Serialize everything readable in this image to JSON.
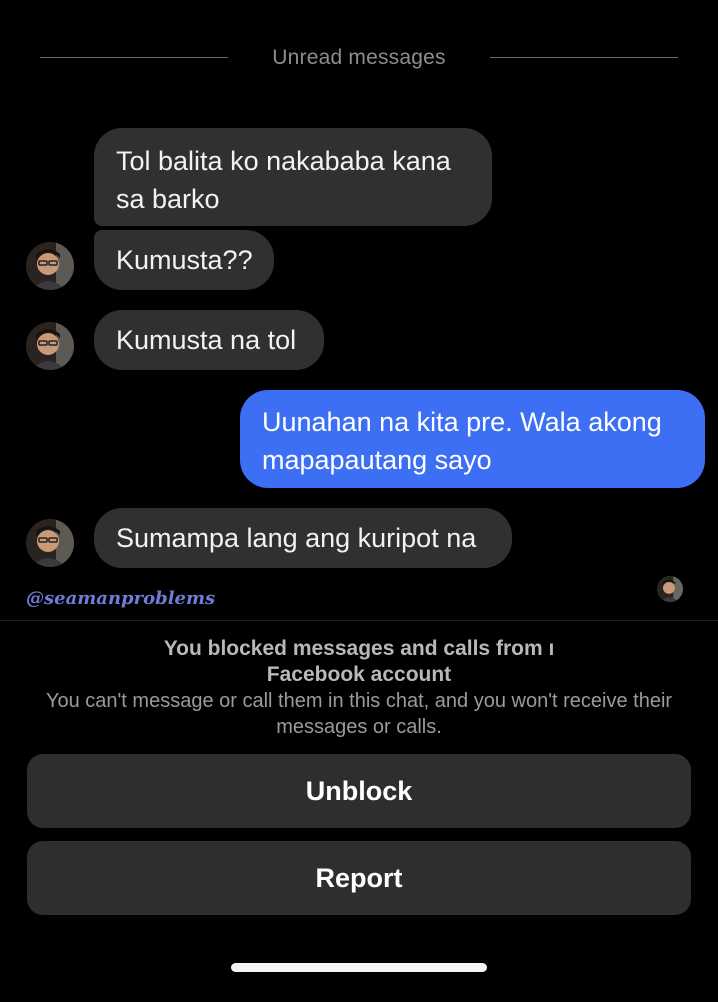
{
  "divider": {
    "label": "Unread messages"
  },
  "messages": [
    {
      "sender": "them",
      "text": "Tol balita ko nakababa kana sa barko",
      "avatar": false
    },
    {
      "sender": "them",
      "text": "Kumusta??",
      "avatar": true
    },
    {
      "sender": "them",
      "text": "Kumusta na tol",
      "avatar": true
    },
    {
      "sender": "me",
      "text": "Uunahan na kita pre. Wala akong mapapautang sayo"
    },
    {
      "sender": "them",
      "text": "Sumampa lang ang kuripot na",
      "avatar": true
    }
  ],
  "watermark": "@seamanproblems",
  "blocked": {
    "title_line1": "You blocked messages and calls from ı",
    "title_line2": "Facebook account",
    "subtitle": "You can't message or call them in this chat, and you won't receive their messages or calls."
  },
  "actions": {
    "unblock_label": "Unblock",
    "report_label": "Report"
  },
  "colors": {
    "background": "#000000",
    "incoming_bubble": "#303030",
    "outgoing_bubble": "#3d6ff5",
    "action_button": "#2e2e2e"
  },
  "icons": {
    "contact_avatar": "profile-photo",
    "seen_indicator": "profile-photo-small"
  }
}
